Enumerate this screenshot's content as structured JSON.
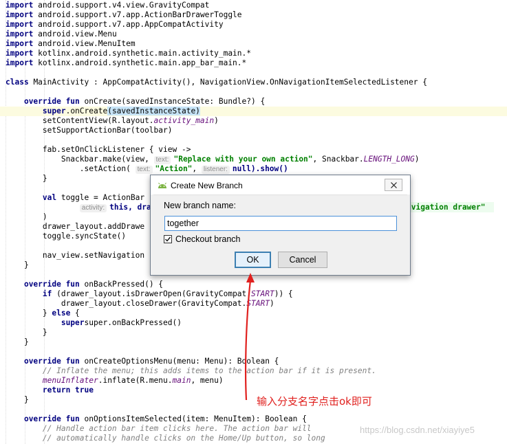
{
  "code": {
    "imports": [
      "android.support.v4.view.GravityCompat",
      "android.support.v7.app.ActionBarDrawerToggle",
      "android.support.v7.app.AppCompatActivity",
      "android.view.Menu",
      "android.view.MenuItem",
      "kotlinx.android.synthetic.main.activity_main.*",
      "kotlinx.android.synthetic.main.app_bar_main.*"
    ],
    "class_decl": "MainActivity : AppCompatActivity(), NavigationView.OnNavigationItemSelectedListener {",
    "oncreate_sig": "onCreate(savedInstanceState: Bundle?) {",
    "super_oncreate": "(savedInstanceState)",
    "set_content_view": "setContentView(R.layout.",
    "activity_main": "activity_main",
    "set_support_action_bar": "setSupportActionBar(toolbar)",
    "fab_listener": "fab.setOnClickListener { view ->",
    "snackbar_make": "Snackbar.make(view,",
    "hint_text": "text:",
    "replace_str": "\"Replace with your own action\"",
    "length_long": "LENGTH_LONG",
    "set_action": ".setAction(",
    "action_str": "\"Action\"",
    "hint_listener": "listener:",
    "null_show": "null).show()",
    "val_toggle": "toggle = ActionBar",
    "hint_activity": "activity:",
    "this_draw": "this, draw",
    "nav_drawer_str": "avigation drawer\"",
    "drawer_add": "drawer_layout.addDrawe",
    "toggle_sync": "toggle.syncState()",
    "nav_view_set": "nav_view.setNavigation",
    "on_back_sig": "onBackPressed() {",
    "is_drawer_open": "(drawer_layout.isDrawerOpen(GravityCompat.",
    "start": "START",
    "close_drawer": "drawer_layout.closeDrawer(GravityCompat.",
    "super_on_back": "super.onBackPressed()",
    "on_create_options_sig": "onCreateOptionsMenu(menu: Menu): Boolean {",
    "comment_inflate": "// Inflate the menu; this adds items to the action bar if it is present.",
    "menu_inflater": "menuInflater",
    "inflate_call": ".inflate(R.menu.",
    "main": "main",
    "menu_close": ", menu)",
    "on_options_selected_sig": "onOptionsItemSelected(item: MenuItem): Boolean {",
    "comment_handle": "// Handle action bar item clicks here. The action bar will",
    "comment_auto": "// automatically handle clicks on the Home/Up button, so long"
  },
  "dialog": {
    "title": "Create New Branch",
    "label": "New branch name:",
    "branch_name": "together",
    "checkout_label": "Checkout branch",
    "checkout_checked": true,
    "ok_label": "OK",
    "cancel_label": "Cancel"
  },
  "annotation": {
    "text": "输入分支名字点击ok即可",
    "color": "#e0201e"
  },
  "watermark": "https://blog.csdn.net/xiayiye5"
}
